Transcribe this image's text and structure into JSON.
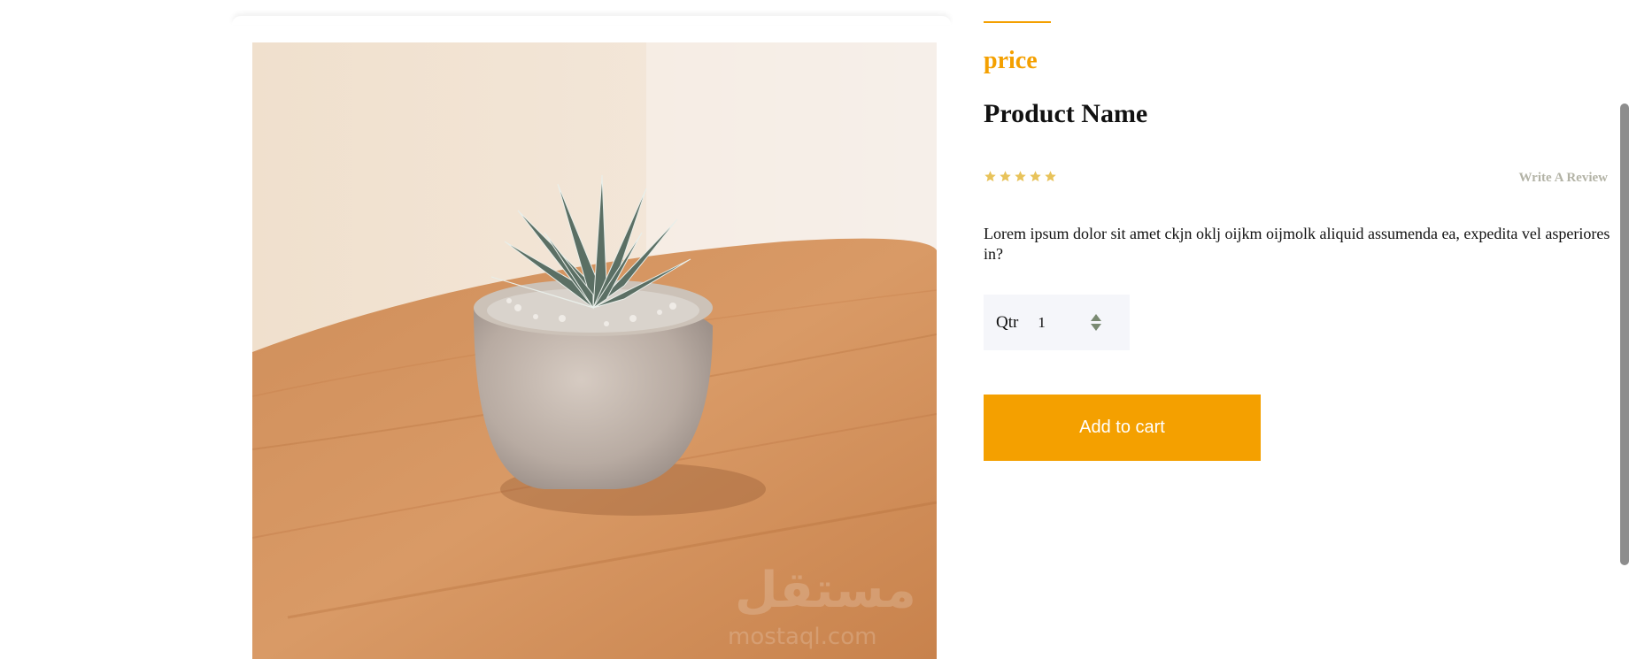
{
  "product": {
    "price_label": "price",
    "name": "Product Name",
    "rating": 5,
    "rating_max": 5,
    "write_review_label": "Write A Review",
    "description": "Lorem ipsum dolor sit amet ckjn oklj oijkm oijmolk aliquid assumenda ea, expedita vel asperiores in?",
    "quantity_label": "Qtr",
    "quantity_value": "1",
    "add_to_cart_label": "Add to cart"
  },
  "image": {
    "subject": "succulent plant in ceramic pot on wooden table",
    "watermark_text": "مستقل",
    "watermark_domain": "mostaql.com"
  },
  "colors": {
    "accent": "#f4a000",
    "star": "#e8c35a",
    "review_link": "#b3b3a6",
    "qty_bg": "#f5f6fa"
  },
  "icons": {
    "star": "star-icon",
    "stepper": "stepper-arrows-icon"
  }
}
